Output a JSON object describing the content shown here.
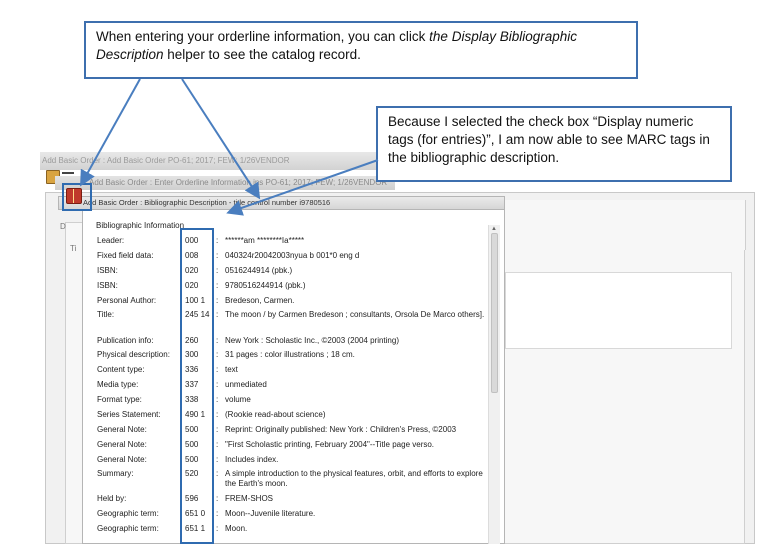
{
  "window": {
    "title1": "Add Basic Order : Add Basic Order  PO-61; 2017; FEW; 1/26VENDOR",
    "title2": "Add Basic Order : Enter Orderline Information ins  PO-61; 2017; FEW; 1/26VENDOR"
  },
  "dialog": {
    "title": "Add Basic Order : Bibliographic Description - title control number i9780516",
    "header": "Bibliographic Information"
  },
  "bib_rows": [
    {
      "label": "Leader:",
      "tag": "000",
      "value": "******am ********Ia*****"
    },
    {
      "label": "Fixed field data:",
      "tag": "008",
      "value": "040324r20042003nyua    b        001*0 eng d"
    },
    {
      "label": "ISBN:",
      "tag": "020",
      "value": "0516244914 (pbk.)"
    },
    {
      "label": "ISBN:",
      "tag": "020",
      "value": "9780516244914 (pbk.)"
    },
    {
      "label": "Personal Author:",
      "tag": "100 1",
      "value": "Bredeson, Carmen."
    },
    {
      "label": "Title:",
      "tag": "245 14",
      "value": "The moon / by Carmen Bredeson ; consultants, Orsola De Marco others]."
    },
    {
      "label": "Publication info:",
      "tag": "260",
      "value": "New York : Scholastic Inc., ©2003 (2004 printing)"
    },
    {
      "label": "Physical description:",
      "tag": "300",
      "value": "31 pages : color illustrations ; 18 cm."
    },
    {
      "label": "Content type:",
      "tag": "336",
      "value": "text"
    },
    {
      "label": "Media type:",
      "tag": "337",
      "value": "unmediated"
    },
    {
      "label": "Format type:",
      "tag": "338",
      "value": "volume"
    },
    {
      "label": "Series Statement:",
      "tag": "490 1",
      "value": "(Rookie read-about science)"
    },
    {
      "label": "General Note:",
      "tag": "500",
      "value": "Reprint: Originally published: New York : Children's Press, ©2003"
    },
    {
      "label": "General Note:",
      "tag": "500",
      "value": "\"First Scholastic printing, February 2004\"--Title page verso."
    },
    {
      "label": "General Note:",
      "tag": "500",
      "value": "Includes index."
    },
    {
      "label": "Summary:",
      "tag": "520",
      "value": "A simple introduction to the physical features, orbit, and efforts to explore the Earth's moon."
    },
    {
      "label": "Held by:",
      "tag": "596",
      "value": "FREM-SHOS"
    },
    {
      "label": "Geographic term:",
      "tag": "651  0",
      "value": "Moon--Juvenile literature."
    },
    {
      "label": "Geographic term:",
      "tag": "651  1",
      "value": "Moon."
    }
  ],
  "callouts": {
    "one_pre": "When entering your orderline information, you can click ",
    "one_em": "the Display Bibliographic Description",
    "one_post": " helper to see the catalog record.",
    "two": "Because I selected the check box “Display numeric tags (for entries)”, I am now able to see MARC tags in the bibliographic description."
  },
  "side_letters": {
    "d": "D",
    "t": "Ti"
  },
  "colors": {
    "callout_border": "#3e6fae",
    "highlight": "#2f6bb0",
    "arrow": "#4a7ebf"
  }
}
